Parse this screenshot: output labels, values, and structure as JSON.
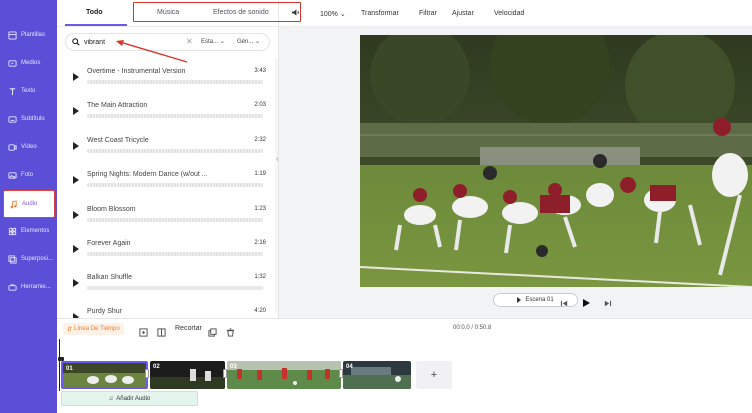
{
  "sidebar": {
    "items": [
      {
        "label": "Plantillas",
        "icon": "template-icon"
      },
      {
        "label": "Medios",
        "icon": "media-icon"
      },
      {
        "label": "Texto",
        "icon": "text-icon"
      },
      {
        "label": "Subtítulo",
        "icon": "subtitle-icon"
      },
      {
        "label": "Vídeo",
        "icon": "video-icon"
      },
      {
        "label": "Foto",
        "icon": "photo-icon"
      },
      {
        "label": "Audio",
        "icon": "audio-icon",
        "active": true
      },
      {
        "label": "Elementos",
        "icon": "elements-icon"
      },
      {
        "label": "Superposi...",
        "icon": "overlay-icon"
      },
      {
        "label": "Herramie...",
        "icon": "tools-icon"
      }
    ]
  },
  "panel": {
    "tabs": {
      "todo": "Todo",
      "musica": "Música",
      "efectos": "Efectos de sonido"
    },
    "search": {
      "value": "vibrant",
      "dropdown1": "Esta...",
      "dropdown2": "Gén..."
    },
    "tracks": [
      {
        "title": "Overtime - Instrumental Version",
        "duration": "3:43"
      },
      {
        "title": "The Main Attraction",
        "duration": "2:03"
      },
      {
        "title": "West Coast Tricycle",
        "duration": "2:32"
      },
      {
        "title": "Spring Nights: Modern Dance (w/out ...",
        "duration": "1:19"
      },
      {
        "title": "Bloom Blossom",
        "duration": "1:23"
      },
      {
        "title": "Forever Again",
        "duration": "2:16"
      },
      {
        "title": "Balkan Shuffle",
        "duration": "1:32"
      },
      {
        "title": "Purdy Shur",
        "duration": "4:20"
      }
    ]
  },
  "toolbar": {
    "zoom": "100%",
    "transform": "Transformar",
    "filter": "Filtrar",
    "adjust": "Ajustar",
    "speed": "Velocidad"
  },
  "player": {
    "scene_label": "Escena 01"
  },
  "timeline": {
    "timeline_label": "Línea De Tiempo",
    "trim": "Recortar",
    "timecode": "00:0.0 / 0:50.8",
    "clips": [
      "01",
      "02",
      "03",
      "04"
    ],
    "add_audio": "Añadir Audio"
  },
  "colors": {
    "sidebar": "#5a4fd6",
    "accent": "#6b5ae8",
    "highlight": "#d9342b",
    "timeline_orange": "#f07a2e"
  }
}
